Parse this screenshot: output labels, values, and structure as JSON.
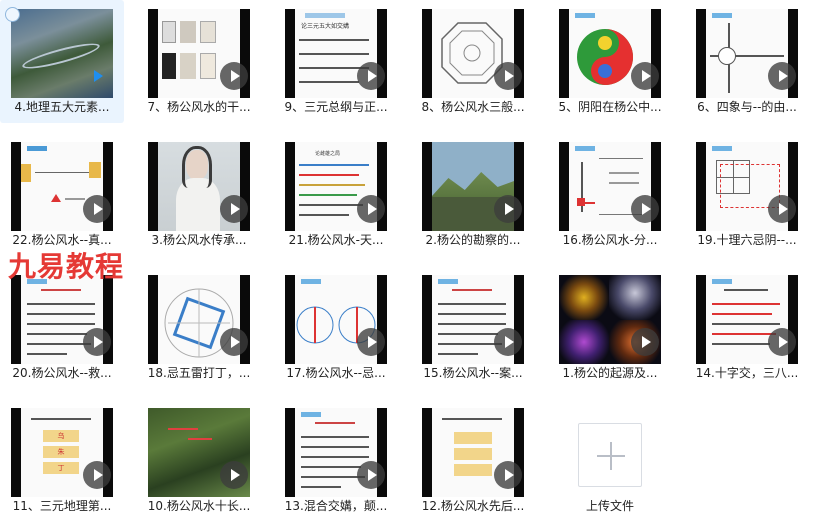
{
  "files": [
    {
      "label": "4.地理五大元素...",
      "kind": "landscape",
      "selected": true
    },
    {
      "label": "7、杨公风水的干...",
      "kind": "photos"
    },
    {
      "label": "9、三元总纲与正...",
      "kind": "text-title"
    },
    {
      "label": "8、杨公风水三般...",
      "kind": "octagon"
    },
    {
      "label": "5、阴阳在杨公中...",
      "kind": "taiji"
    },
    {
      "label": "6、四象与--的由...",
      "kind": "axes"
    },
    {
      "label": "22.杨公风水--真...",
      "kind": "diagram-yellow"
    },
    {
      "label": "3.杨公风水传承...",
      "kind": "portrait"
    },
    {
      "label": "21.杨公风水-天...",
      "kind": "table-text"
    },
    {
      "label": "2.杨公的勘察的...",
      "kind": "mountain"
    },
    {
      "label": "16.杨公风水-分...",
      "kind": "chart-red"
    },
    {
      "label": "19.十理六忌阴--...",
      "kind": "grid-diagram"
    },
    {
      "label": "20.杨公风水--救...",
      "kind": "text-doc"
    },
    {
      "label": "18.忌五雷打丁，...",
      "kind": "compass-square"
    },
    {
      "label": "17.杨公风水--忌...",
      "kind": "compass-pair"
    },
    {
      "label": "15.杨公风水--案...",
      "kind": "text-doc"
    },
    {
      "label": "1.杨公的起源及...",
      "kind": "space"
    },
    {
      "label": "14.十字交，三八...",
      "kind": "text-red"
    },
    {
      "label": "11、三元地理第...",
      "kind": "yellow-boxes"
    },
    {
      "label": "10.杨公风水十长...",
      "kind": "green-map"
    },
    {
      "label": "13.混合交媾，颠...",
      "kind": "text-doc"
    },
    {
      "label": "12.杨公风水先后...",
      "kind": "yellow-boxes-2"
    }
  ],
  "upload": {
    "label": "上传文件"
  },
  "watermark": {
    "text": "九易教程"
  },
  "thumb_text": {
    "text_title": "论三元五大如交媾",
    "table_text": "论雌雄之局",
    "yellow_boxes": [
      "乌",
      "朱",
      "丁"
    ]
  },
  "colors": {
    "selected_bg": "#eaf4fe",
    "watermark": "#e53935",
    "play_blue": "#1e8ef0"
  }
}
